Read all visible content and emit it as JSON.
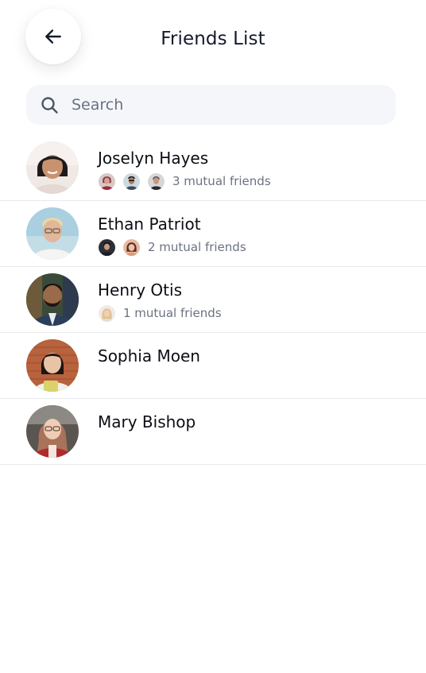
{
  "header": {
    "title": "Friends List",
    "back_icon": "arrow-left-icon"
  },
  "search": {
    "placeholder": "Search",
    "value": "",
    "icon": "search-icon"
  },
  "friends": [
    {
      "name": "Joselyn Hayes",
      "mutual_text": "3 mutual friends",
      "mutual_count": 3
    },
    {
      "name": "Ethan Patriot",
      "mutual_text": "2 mutual friends",
      "mutual_count": 2
    },
    {
      "name": "Henry Otis",
      "mutual_text": "1 mutual friends",
      "mutual_count": 1
    },
    {
      "name": "Sophia Moen",
      "mutual_text": "",
      "mutual_count": 0
    },
    {
      "name": "Mary Bishop",
      "mutual_text": "",
      "mutual_count": 0
    }
  ],
  "colors": {
    "title": "#141a2e",
    "search_bg": "#f4f6fa",
    "muted_text": "#6b7280",
    "divider": "#e7e9ee"
  }
}
